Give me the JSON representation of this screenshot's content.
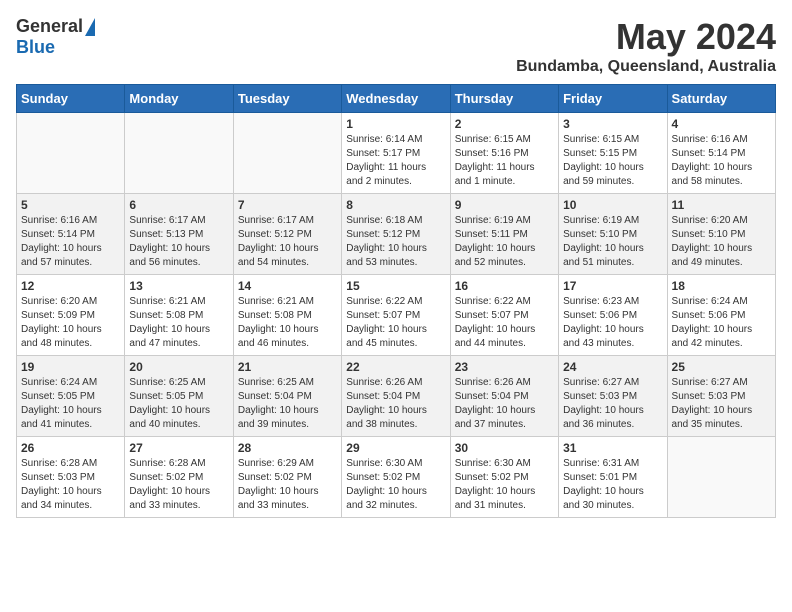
{
  "header": {
    "logo_general": "General",
    "logo_blue": "Blue",
    "month_year": "May 2024",
    "location": "Bundamba, Queensland, Australia"
  },
  "days_of_week": [
    "Sunday",
    "Monday",
    "Tuesday",
    "Wednesday",
    "Thursday",
    "Friday",
    "Saturday"
  ],
  "weeks": [
    [
      {
        "day": "",
        "info": ""
      },
      {
        "day": "",
        "info": ""
      },
      {
        "day": "",
        "info": ""
      },
      {
        "day": "1",
        "info": "Sunrise: 6:14 AM\nSunset: 5:17 PM\nDaylight: 11 hours\nand 2 minutes."
      },
      {
        "day": "2",
        "info": "Sunrise: 6:15 AM\nSunset: 5:16 PM\nDaylight: 11 hours\nand 1 minute."
      },
      {
        "day": "3",
        "info": "Sunrise: 6:15 AM\nSunset: 5:15 PM\nDaylight: 10 hours\nand 59 minutes."
      },
      {
        "day": "4",
        "info": "Sunrise: 6:16 AM\nSunset: 5:14 PM\nDaylight: 10 hours\nand 58 minutes."
      }
    ],
    [
      {
        "day": "5",
        "info": "Sunrise: 6:16 AM\nSunset: 5:14 PM\nDaylight: 10 hours\nand 57 minutes."
      },
      {
        "day": "6",
        "info": "Sunrise: 6:17 AM\nSunset: 5:13 PM\nDaylight: 10 hours\nand 56 minutes."
      },
      {
        "day": "7",
        "info": "Sunrise: 6:17 AM\nSunset: 5:12 PM\nDaylight: 10 hours\nand 54 minutes."
      },
      {
        "day": "8",
        "info": "Sunrise: 6:18 AM\nSunset: 5:12 PM\nDaylight: 10 hours\nand 53 minutes."
      },
      {
        "day": "9",
        "info": "Sunrise: 6:19 AM\nSunset: 5:11 PM\nDaylight: 10 hours\nand 52 minutes."
      },
      {
        "day": "10",
        "info": "Sunrise: 6:19 AM\nSunset: 5:10 PM\nDaylight: 10 hours\nand 51 minutes."
      },
      {
        "day": "11",
        "info": "Sunrise: 6:20 AM\nSunset: 5:10 PM\nDaylight: 10 hours\nand 49 minutes."
      }
    ],
    [
      {
        "day": "12",
        "info": "Sunrise: 6:20 AM\nSunset: 5:09 PM\nDaylight: 10 hours\nand 48 minutes."
      },
      {
        "day": "13",
        "info": "Sunrise: 6:21 AM\nSunset: 5:08 PM\nDaylight: 10 hours\nand 47 minutes."
      },
      {
        "day": "14",
        "info": "Sunrise: 6:21 AM\nSunset: 5:08 PM\nDaylight: 10 hours\nand 46 minutes."
      },
      {
        "day": "15",
        "info": "Sunrise: 6:22 AM\nSunset: 5:07 PM\nDaylight: 10 hours\nand 45 minutes."
      },
      {
        "day": "16",
        "info": "Sunrise: 6:22 AM\nSunset: 5:07 PM\nDaylight: 10 hours\nand 44 minutes."
      },
      {
        "day": "17",
        "info": "Sunrise: 6:23 AM\nSunset: 5:06 PM\nDaylight: 10 hours\nand 43 minutes."
      },
      {
        "day": "18",
        "info": "Sunrise: 6:24 AM\nSunset: 5:06 PM\nDaylight: 10 hours\nand 42 minutes."
      }
    ],
    [
      {
        "day": "19",
        "info": "Sunrise: 6:24 AM\nSunset: 5:05 PM\nDaylight: 10 hours\nand 41 minutes."
      },
      {
        "day": "20",
        "info": "Sunrise: 6:25 AM\nSunset: 5:05 PM\nDaylight: 10 hours\nand 40 minutes."
      },
      {
        "day": "21",
        "info": "Sunrise: 6:25 AM\nSunset: 5:04 PM\nDaylight: 10 hours\nand 39 minutes."
      },
      {
        "day": "22",
        "info": "Sunrise: 6:26 AM\nSunset: 5:04 PM\nDaylight: 10 hours\nand 38 minutes."
      },
      {
        "day": "23",
        "info": "Sunrise: 6:26 AM\nSunset: 5:04 PM\nDaylight: 10 hours\nand 37 minutes."
      },
      {
        "day": "24",
        "info": "Sunrise: 6:27 AM\nSunset: 5:03 PM\nDaylight: 10 hours\nand 36 minutes."
      },
      {
        "day": "25",
        "info": "Sunrise: 6:27 AM\nSunset: 5:03 PM\nDaylight: 10 hours\nand 35 minutes."
      }
    ],
    [
      {
        "day": "26",
        "info": "Sunrise: 6:28 AM\nSunset: 5:03 PM\nDaylight: 10 hours\nand 34 minutes."
      },
      {
        "day": "27",
        "info": "Sunrise: 6:28 AM\nSunset: 5:02 PM\nDaylight: 10 hours\nand 33 minutes."
      },
      {
        "day": "28",
        "info": "Sunrise: 6:29 AM\nSunset: 5:02 PM\nDaylight: 10 hours\nand 33 minutes."
      },
      {
        "day": "29",
        "info": "Sunrise: 6:30 AM\nSunset: 5:02 PM\nDaylight: 10 hours\nand 32 minutes."
      },
      {
        "day": "30",
        "info": "Sunrise: 6:30 AM\nSunset: 5:02 PM\nDaylight: 10 hours\nand 31 minutes."
      },
      {
        "day": "31",
        "info": "Sunrise: 6:31 AM\nSunset: 5:01 PM\nDaylight: 10 hours\nand 30 minutes."
      },
      {
        "day": "",
        "info": ""
      }
    ]
  ]
}
